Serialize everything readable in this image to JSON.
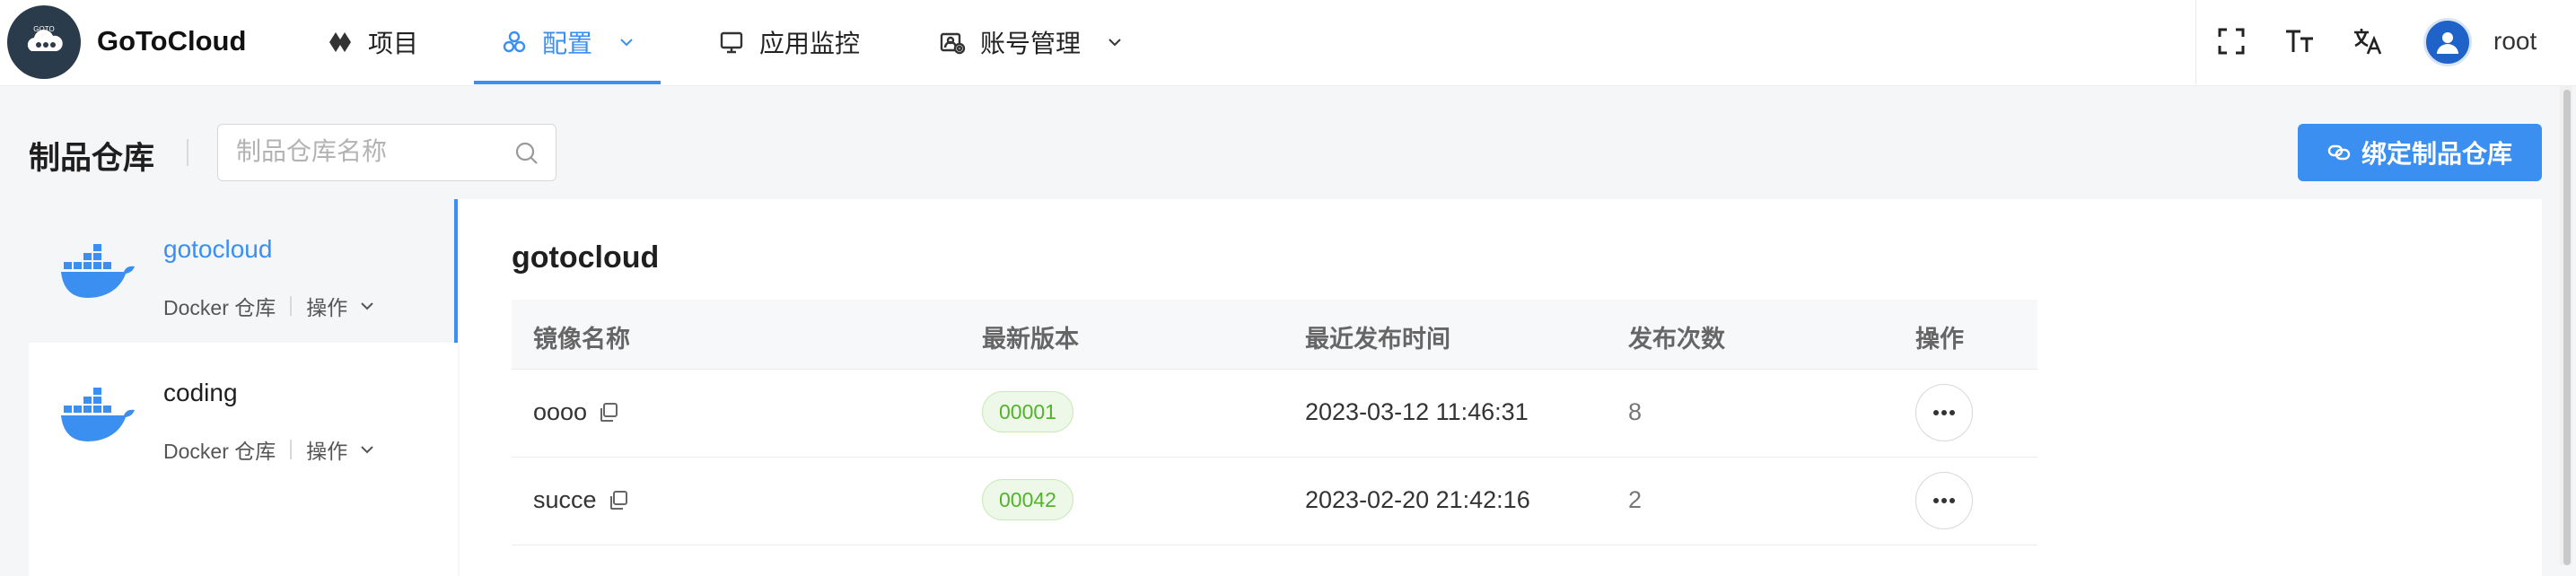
{
  "app": {
    "brand": "GoToCloud",
    "logo_text": "GOTO"
  },
  "nav": {
    "items": [
      {
        "label": "项目",
        "icon": "project-icon"
      },
      {
        "label": "配置",
        "icon": "config-icon",
        "active": true
      },
      {
        "label": "应用监控",
        "icon": "monitor-icon"
      },
      {
        "label": "账号管理",
        "icon": "account-icon"
      }
    ]
  },
  "user": {
    "name": "root"
  },
  "header": {
    "title": "制品仓库",
    "search_placeholder": "制品仓库名称",
    "bind_button": "绑定制品仓库"
  },
  "repos": [
    {
      "name": "gotocloud",
      "type": "Docker 仓库",
      "ops": "操作",
      "selected": true
    },
    {
      "name": "coding",
      "type": "Docker 仓库",
      "ops": "操作",
      "selected": false
    }
  ],
  "main": {
    "title": "gotocloud",
    "columns": [
      "镜像名称",
      "最新版本",
      "最近发布时间",
      "发布次数",
      "操作"
    ],
    "rows": [
      {
        "name": "oooo",
        "version": "00001",
        "time": "2023-03-12 11:46:31",
        "count": "8"
      },
      {
        "name": "succe",
        "version": "00042",
        "time": "2023-02-20 21:42:16",
        "count": "2"
      }
    ]
  },
  "colors": {
    "accent": "#3b8ff0",
    "tag_green": "#52b32b",
    "logo_bg": "#2a3b4c"
  }
}
